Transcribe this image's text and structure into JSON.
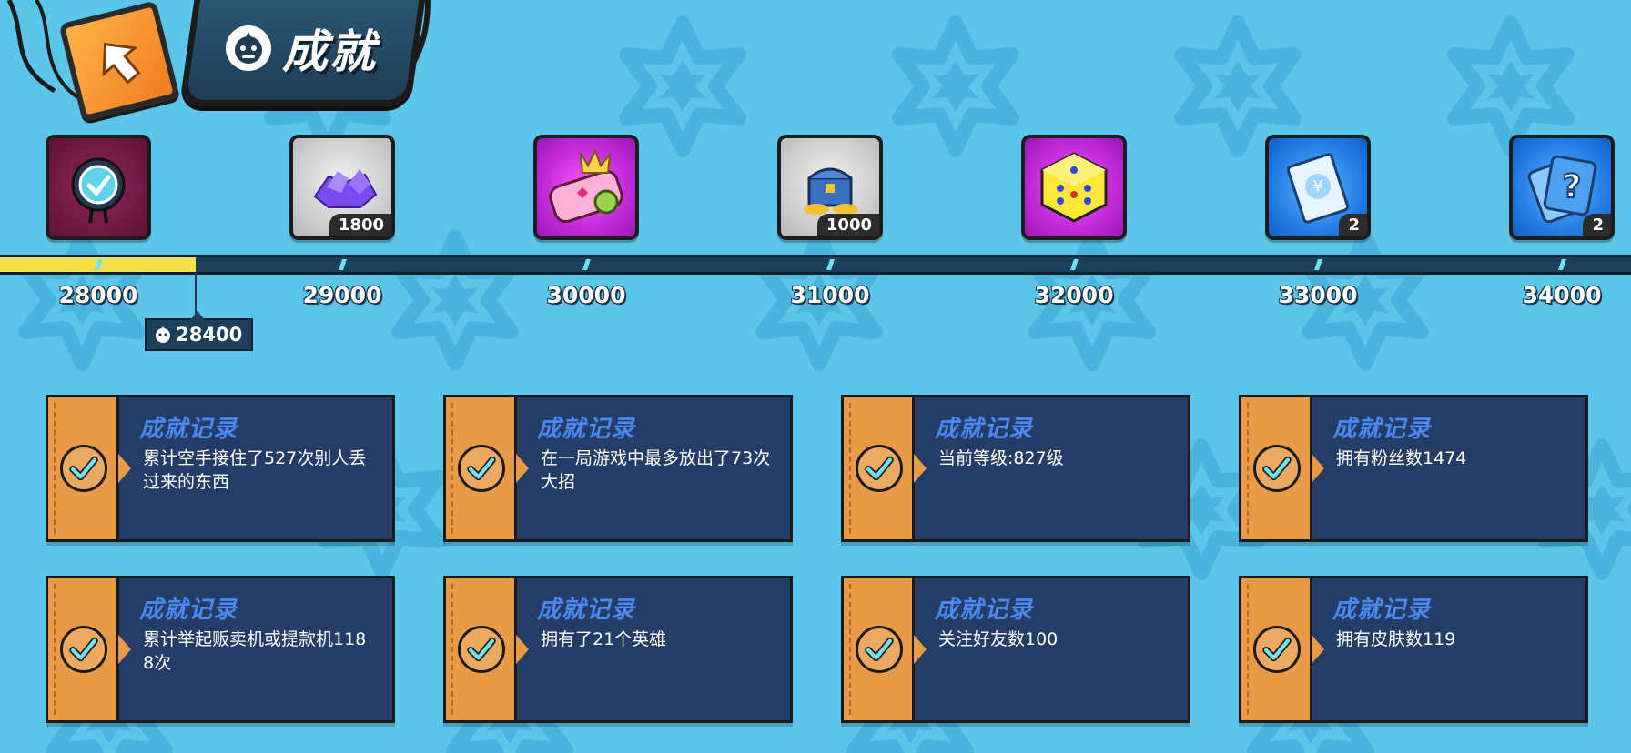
{
  "header": {
    "title": "成就"
  },
  "rewards": [
    {
      "milestone": "28000",
      "icon": "checked-avatar-icon",
      "count": ""
    },
    {
      "milestone": "29000",
      "icon": "gem-pile-icon",
      "count": "1800"
    },
    {
      "milestone": "30000",
      "icon": "crown-skin-icon",
      "count": ""
    },
    {
      "milestone": "31000",
      "icon": "treasure-chest-icon",
      "count": "1000"
    },
    {
      "milestone": "32000",
      "icon": "dice-icon",
      "count": ""
    },
    {
      "milestone": "33000",
      "icon": "ticket-icon",
      "count": "2"
    },
    {
      "milestone": "34000",
      "icon": "mystery-card-icon",
      "count": "2"
    }
  ],
  "progress": {
    "current": "28400",
    "fraction_to_next": 0.4
  },
  "achievements": [
    {
      "title": "成就记录",
      "text": "累计空手接住了527次别人丢过来的东西"
    },
    {
      "title": "成就记录",
      "text": "在一局游戏中最多放出了73次大招"
    },
    {
      "title": "成就记录",
      "text": "当前等级:827级"
    },
    {
      "title": "成就记录",
      "text": "拥有粉丝数1474"
    },
    {
      "title": "成就记录",
      "text": "累计举起贩卖机或提款机1188次"
    },
    {
      "title": "成就记录",
      "text": "拥有了21个英雄"
    },
    {
      "title": "成就记录",
      "text": "关注好友数100"
    },
    {
      "title": "成就记录",
      "text": "拥有皮肤数119"
    }
  ],
  "colors": {
    "background": "#5cc6ea",
    "card": "#233d66",
    "card_side": "#e89a46",
    "card_title": "#4b88f0",
    "progress_fill": "#f6e04a",
    "check": "#6fe3ef"
  }
}
